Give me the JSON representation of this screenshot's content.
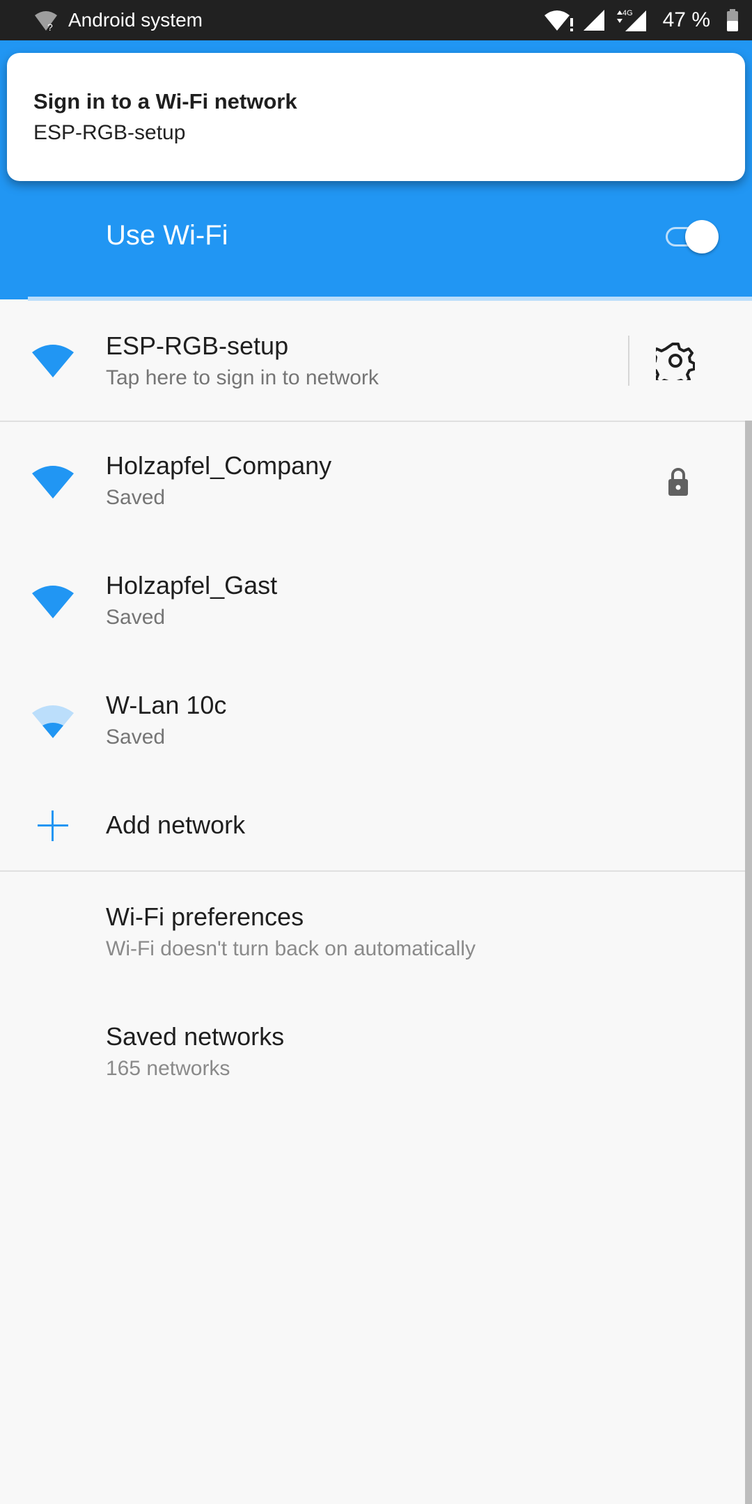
{
  "status_bar": {
    "app_name": "Android system",
    "network_type": "4G",
    "battery": "47 %"
  },
  "notification": {
    "title": "Sign in to a Wi-Fi network",
    "text": "ESP-RGB-setup"
  },
  "header": {
    "title": "Use Wi-Fi",
    "toggle_on": true
  },
  "connected_network": {
    "name": "ESP-RGB-setup",
    "status": "Tap here to sign in to network"
  },
  "networks": [
    {
      "name": "Holzapfel_Company",
      "status": "Saved",
      "secured": true,
      "signal": "full"
    },
    {
      "name": "Holzapfel_Gast",
      "status": "Saved",
      "secured": false,
      "signal": "full"
    },
    {
      "name": "W-Lan 10c",
      "status": "Saved",
      "secured": false,
      "signal": "weak"
    }
  ],
  "add_network": {
    "label": "Add network"
  },
  "preferences": {
    "title": "Wi-Fi preferences",
    "subtitle": "Wi-Fi doesn't turn back on automatically"
  },
  "saved_networks": {
    "title": "Saved networks",
    "subtitle": "165 networks"
  },
  "colors": {
    "accent": "#2196f3",
    "status_bar": "#212121",
    "background": "#f8f8f8"
  }
}
